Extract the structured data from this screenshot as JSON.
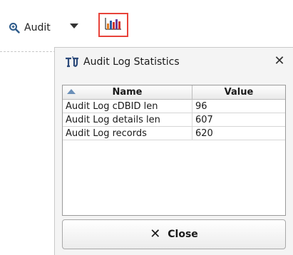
{
  "toolbar": {
    "audit_label": "Audit",
    "audit_icon": "magnifier-icon",
    "dropdown_icon": "triangle-down-icon",
    "stats_icon": "bar-chart-icon",
    "highlight_color": "#e8433a"
  },
  "dialog": {
    "title": "Audit Log Statistics",
    "title_icon": "statistics-icon",
    "close_glyph": "✕",
    "table": {
      "columns": [
        "Name",
        "Value"
      ],
      "sorted_column": "Name",
      "rows": [
        {
          "name": "Audit Log cDBID len",
          "value": "96"
        },
        {
          "name": "Audit Log details len",
          "value": "607"
        },
        {
          "name": "Audit Log records",
          "value": "620"
        }
      ]
    },
    "close_button": {
      "glyph": "✕",
      "label": "Close"
    }
  }
}
